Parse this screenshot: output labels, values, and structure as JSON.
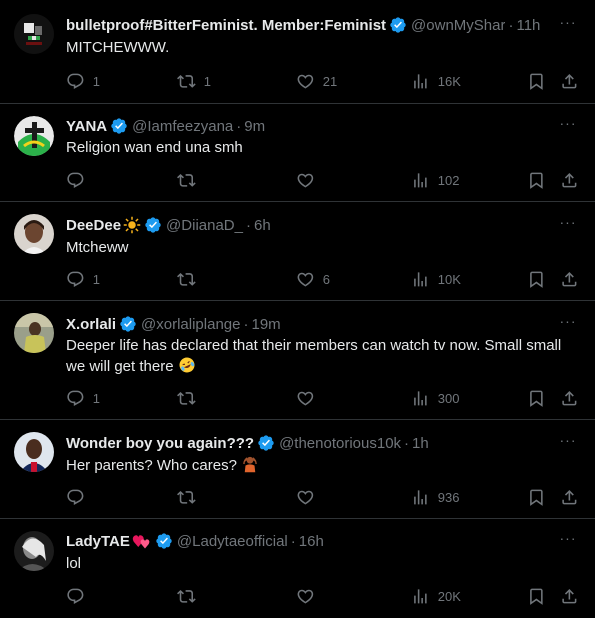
{
  "colors": {
    "background": "#000000",
    "text": "#e7e9ea",
    "secondary": "#71767b",
    "verified": "#1d9bf0",
    "divider": "#2f3336"
  },
  "tweets": [
    {
      "name": "bulletproof#BitterFeminist. Member:Feminist",
      "handle": "@ownMyShar",
      "dot": "·",
      "time": "11h",
      "text": "MITCHEWWW.",
      "replies": "1",
      "retweets": "1",
      "likes": "21",
      "views": "16K"
    },
    {
      "name": "YANA",
      "handle": "@Iamfeezyana",
      "dot": "·",
      "time": "9m",
      "text": "Religion wan end una smh",
      "replies": "",
      "retweets": "",
      "likes": "",
      "views": "102"
    },
    {
      "name": "DeeDee",
      "handle": "@DiianaD_",
      "dot": "·",
      "time": "6h",
      "text": "Mtcheww",
      "replies": "1",
      "retweets": "",
      "likes": "6",
      "views": "10K"
    },
    {
      "name": "X.orlali",
      "handle": "@xorlaliplange",
      "dot": "·",
      "time": "19m",
      "text": "Deeper life has declared that their members can watch tv now. Small small we will get there",
      "replies": "1",
      "retweets": "",
      "likes": "",
      "views": "300"
    },
    {
      "name": "Wonder boy you again???",
      "handle": "@thenotorious10k",
      "dot": "·",
      "time": "1h",
      "text": "Her parents? Who cares?",
      "replies": "",
      "retweets": "",
      "likes": "",
      "views": "936"
    },
    {
      "name": "LadyTAE",
      "handle": "@Ladytaeofficial",
      "dot": "·",
      "time": "16h",
      "text": "lol",
      "replies": "",
      "retweets": "",
      "likes": "",
      "views": "20K"
    }
  ],
  "icons": {
    "reply": "reply-icon",
    "retweet": "retweet-icon",
    "like": "heart-icon",
    "views": "views-icon",
    "bookmark": "bookmark-icon",
    "share": "share-icon",
    "more": "more-icon",
    "verified": "verified-badge-icon"
  }
}
